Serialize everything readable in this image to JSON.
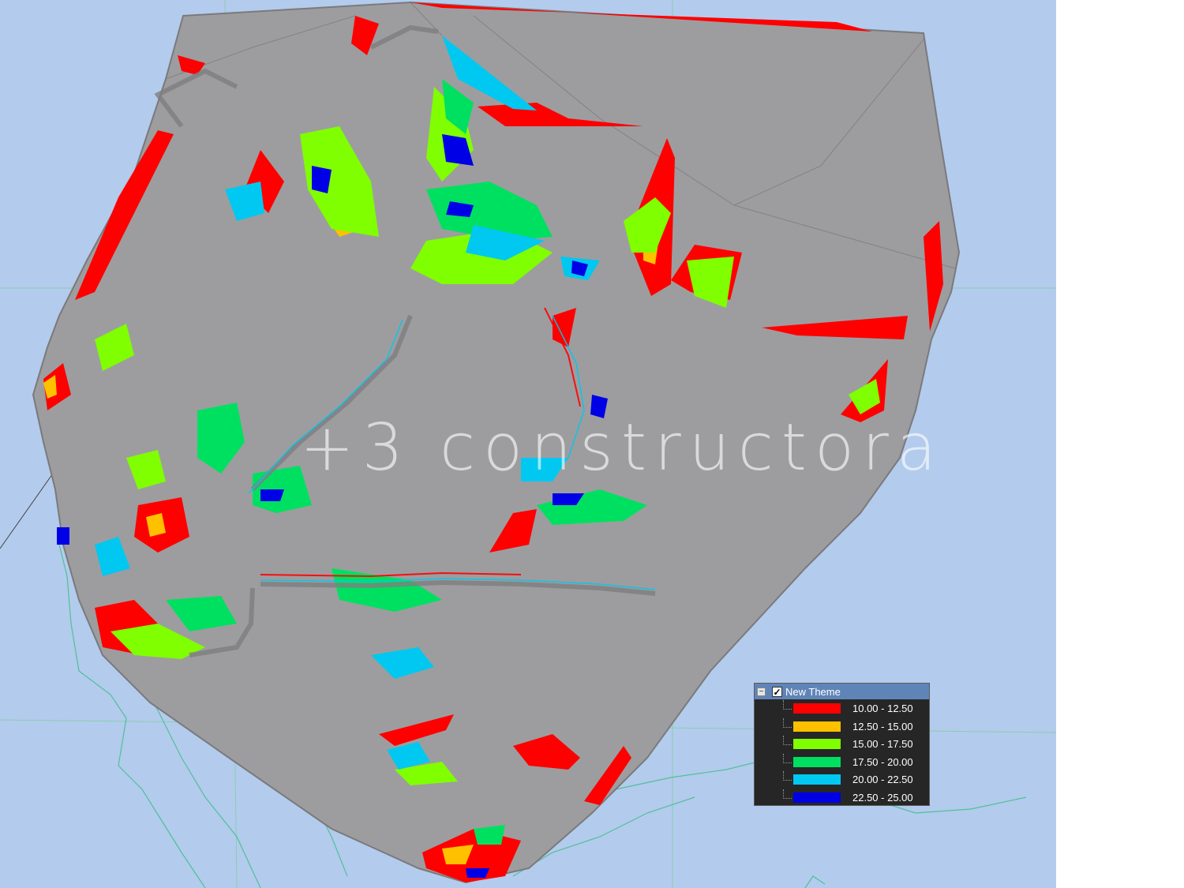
{
  "watermark": "+3 constructora",
  "colors": {
    "background": "#b3cbed",
    "surface": "#9d9d9f",
    "red": "#ff0000",
    "orange": "#ffc000",
    "light_green": "#7fff00",
    "green": "#00e060",
    "cyan": "#00c8f0",
    "blue": "#0000e6"
  },
  "legend": {
    "title": "New Theme",
    "collapse_icon": "minus-box-icon",
    "check_icon": "checkmark-icon",
    "items": [
      {
        "label": "10.00 - 12.50",
        "color": "#ff0000"
      },
      {
        "label": "12.50 - 15.00",
        "color": "#ffc000"
      },
      {
        "label": "15.00 - 17.50",
        "color": "#7fff00"
      },
      {
        "label": "17.50 - 20.00",
        "color": "#00e060"
      },
      {
        "label": "20.00 - 22.50",
        "color": "#00c8f0"
      },
      {
        "label": "22.50 - 25.00",
        "color": "#0000e6"
      }
    ]
  }
}
